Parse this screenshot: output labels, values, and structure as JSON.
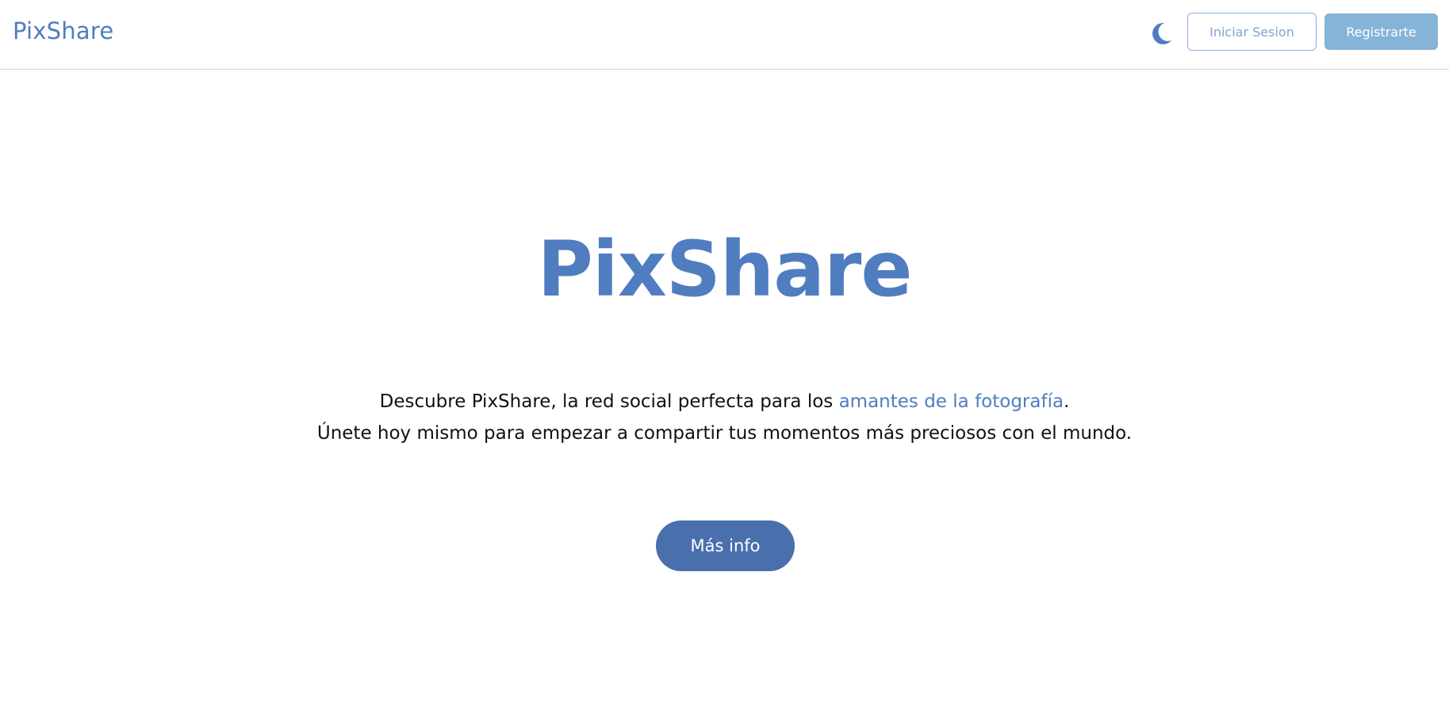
{
  "navbar": {
    "brand": "PixShare",
    "theme_icon": "moon-icon",
    "login_label": "Iniciar Sesion",
    "register_label": "Registrarte"
  },
  "hero": {
    "title": "PixShare",
    "line1_prefix": "Descubre PixShare, la red social perfecta para los ",
    "line1_highlight": "amantes de la fotografía",
    "line1_suffix": ".",
    "line2": "Únete hoy mismo para empezar a compartir tus momentos más preciosos con el mundo.",
    "more_label": "Más info"
  },
  "colors": {
    "brand": "#4f7dbf",
    "register_bg": "#86b3d8",
    "login_border": "#8fb3d8",
    "more_bg": "#4a6fad",
    "divider": "#c9d6e8"
  }
}
